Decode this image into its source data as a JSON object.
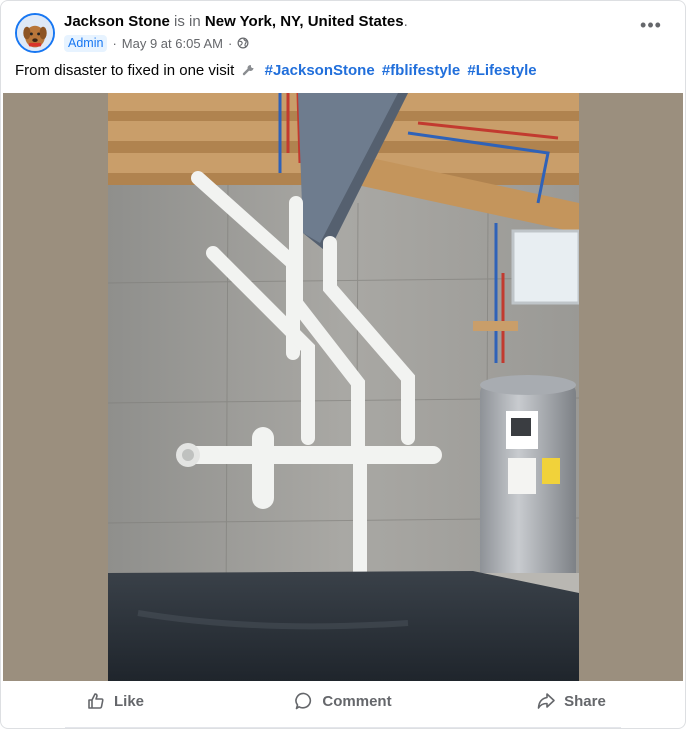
{
  "post": {
    "author": "Jackson Stone",
    "is_in_text": "is in",
    "location": "New York, NY, United States",
    "location_suffix": ".",
    "role_badge": "Admin",
    "separator": "·",
    "timestamp": "May 9 at 6:05 AM",
    "privacy_icon": "globe-icon",
    "more_label": "•••",
    "caption_text": "From disaster to fixed in one visit",
    "caption_icon": "wrench-icon",
    "hashtags": [
      "#JacksonStone",
      "#fblifestyle",
      "#Lifestyle"
    ]
  },
  "actions": {
    "like_label": "Like",
    "comment_label": "Comment",
    "share_label": "Share"
  },
  "colors": {
    "link_blue": "#216fdb",
    "badge_bg": "#e7f3ff",
    "muted_text": "#65676b",
    "photo_backdrop": "#9b8f7e"
  }
}
